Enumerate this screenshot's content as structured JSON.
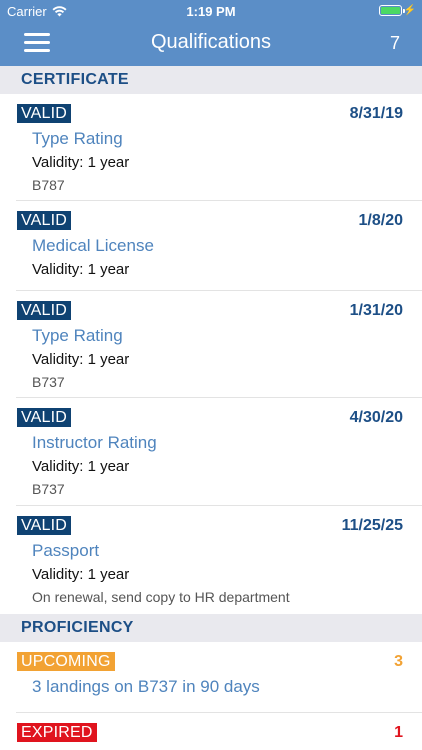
{
  "status_bar": {
    "carrier": "Carrier",
    "time": "1:19 PM",
    "battery_color": "#4cd964"
  },
  "nav": {
    "menu_icon": "hamburger-menu-icon",
    "title": "Qualifications",
    "count": "7"
  },
  "colors": {
    "header_bg": "#5b8ec7",
    "valid_badge": "#0f4272",
    "upcoming_badge": "#f2a233",
    "expired_badge": "#e0141e",
    "link_text": "#4f84bd",
    "section_text": "#1d4f86"
  },
  "sections": {
    "certificate": {
      "title": "CERTIFICATE",
      "items": [
        {
          "status": "VALID",
          "date": "8/31/19",
          "title": "Type Rating",
          "validity": "Validity: 1 year",
          "note": "B787"
        },
        {
          "status": "VALID",
          "date": "1/8/20",
          "title": "Medical License",
          "validity": "Validity: 1 year"
        },
        {
          "status": "VALID",
          "date": "1/31/20",
          "title": "Type Rating",
          "validity": "Validity: 1 year",
          "note": "B737"
        },
        {
          "status": "VALID",
          "date": "4/30/20",
          "title": "Instructor Rating",
          "validity": "Validity: 1 year",
          "note": "B737"
        },
        {
          "status": "VALID",
          "date": "11/25/25",
          "title": "Passport",
          "validity": "Validity: 1 year",
          "note": "On renewal, send copy to HR department"
        }
      ]
    },
    "proficiency": {
      "title": "PROFICIENCY",
      "items": [
        {
          "status": "UPCOMING",
          "count": "3",
          "title": "3 landings on B737 in 90 days"
        },
        {
          "status": "EXPIRED",
          "count": "1"
        }
      ]
    }
  }
}
